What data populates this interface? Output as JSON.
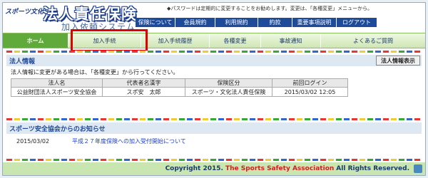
{
  "header": {
    "logo_small": "スポーツ文化",
    "logo_main": "法人責任保険",
    "logo_sub": "加入依頼システム",
    "notice": "◆パスワードは定期的に変更することをお勧めします。変更は、「各種変更」メニューから。"
  },
  "toplinks": [
    "保険について",
    "会員規約",
    "利用規約",
    "約款",
    "重要事項説明",
    "ログアウト"
  ],
  "nav": [
    "ホーム",
    "加入手続",
    "加入手続履歴",
    "各種変更",
    "事故通知",
    "よくあるご質問"
  ],
  "corp_info": {
    "title": "法人情報",
    "button": "法人情報表示",
    "message": "法人情報に変更がある場合は、「各種変更」から行ってください。",
    "columns": [
      "法人名",
      "代表者名漢字",
      "保険区分",
      "前回ログイン"
    ],
    "row": [
      "公益財団法人スポーツ安全協会",
      "スポ安　太郎",
      "スポーツ・文化法人責任保険",
      "2015/03/02 12:05"
    ]
  },
  "news": {
    "title": "スポーツ安全協会からのお知らせ",
    "items": [
      {
        "date": "2015/03/02",
        "text": "平成２７年度保険への加入受付開始について"
      }
    ]
  },
  "footer": {
    "prefix": "Copyright 2015.",
    "org": "The Sports Safety Association",
    "suffix": "All Rights Reserved."
  }
}
